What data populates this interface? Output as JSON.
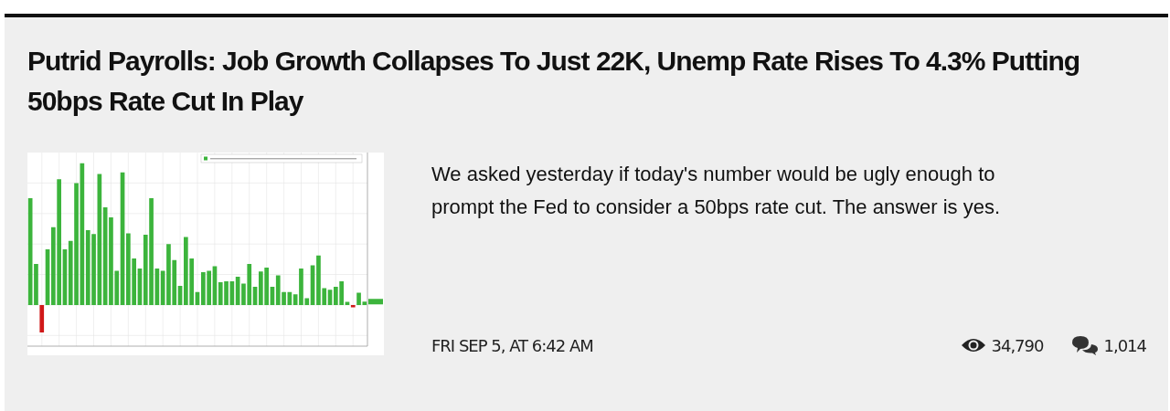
{
  "article": {
    "title": "Putrid Payrolls: Job Growth Collapses To Just 22K, Unemp Rate Rises To 4.3% Putting 50bps Rate Cut In Play",
    "summary": "We asked yesterday if today's number would be ugly enough to prompt the Fed to consider a 50bps rate cut. The answer is yes.",
    "date": "FRI SEP 5, AT 6:42 AM",
    "views": "34,790",
    "comments": "1,014"
  }
}
